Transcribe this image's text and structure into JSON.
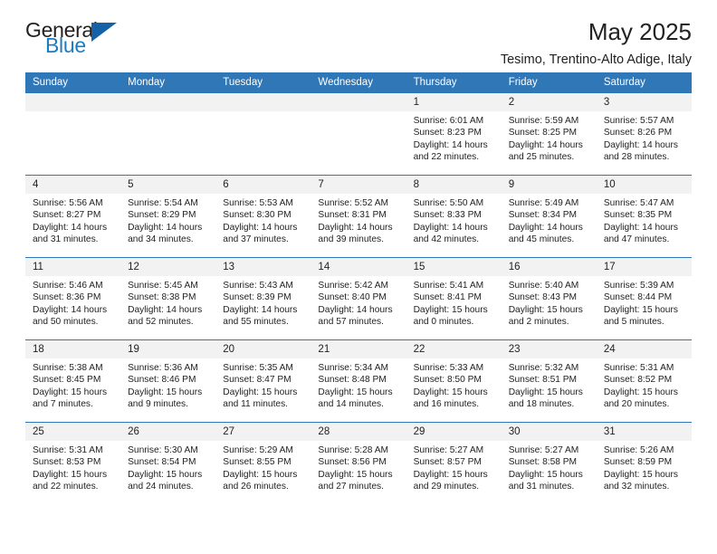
{
  "logo": {
    "word_top": "General",
    "word_bottom": "Blue",
    "triangle_color": "#1461a8",
    "blue_color": "#1c7cc0"
  },
  "header": {
    "title": "May 2025",
    "subtitle": "Tesimo, Trentino-Alto Adige, Italy"
  },
  "colors": {
    "header_row_bg": "#3077b8",
    "day_number_bg": "#f2f2f2",
    "text": "#222222"
  },
  "calendar": {
    "weekday_headers": [
      "Sunday",
      "Monday",
      "Tuesday",
      "Wednesday",
      "Thursday",
      "Friday",
      "Saturday"
    ],
    "labels": {
      "sunrise": "Sunrise:",
      "sunset": "Sunset:",
      "daylight": "Daylight:"
    },
    "weeks": [
      [
        {
          "day": "",
          "empty": true
        },
        {
          "day": "",
          "empty": true
        },
        {
          "day": "",
          "empty": true
        },
        {
          "day": "",
          "empty": true
        },
        {
          "day": "1",
          "sunrise": "Sunrise: 6:01 AM",
          "sunset": "Sunset: 8:23 PM",
          "daylight": "Daylight: 14 hours and 22 minutes."
        },
        {
          "day": "2",
          "sunrise": "Sunrise: 5:59 AM",
          "sunset": "Sunset: 8:25 PM",
          "daylight": "Daylight: 14 hours and 25 minutes."
        },
        {
          "day": "3",
          "sunrise": "Sunrise: 5:57 AM",
          "sunset": "Sunset: 8:26 PM",
          "daylight": "Daylight: 14 hours and 28 minutes."
        }
      ],
      [
        {
          "day": "4",
          "sunrise": "Sunrise: 5:56 AM",
          "sunset": "Sunset: 8:27 PM",
          "daylight": "Daylight: 14 hours and 31 minutes."
        },
        {
          "day": "5",
          "sunrise": "Sunrise: 5:54 AM",
          "sunset": "Sunset: 8:29 PM",
          "daylight": "Daylight: 14 hours and 34 minutes."
        },
        {
          "day": "6",
          "sunrise": "Sunrise: 5:53 AM",
          "sunset": "Sunset: 8:30 PM",
          "daylight": "Daylight: 14 hours and 37 minutes."
        },
        {
          "day": "7",
          "sunrise": "Sunrise: 5:52 AM",
          "sunset": "Sunset: 8:31 PM",
          "daylight": "Daylight: 14 hours and 39 minutes."
        },
        {
          "day": "8",
          "sunrise": "Sunrise: 5:50 AM",
          "sunset": "Sunset: 8:33 PM",
          "daylight": "Daylight: 14 hours and 42 minutes."
        },
        {
          "day": "9",
          "sunrise": "Sunrise: 5:49 AM",
          "sunset": "Sunset: 8:34 PM",
          "daylight": "Daylight: 14 hours and 45 minutes."
        },
        {
          "day": "10",
          "sunrise": "Sunrise: 5:47 AM",
          "sunset": "Sunset: 8:35 PM",
          "daylight": "Daylight: 14 hours and 47 minutes."
        }
      ],
      [
        {
          "day": "11",
          "sunrise": "Sunrise: 5:46 AM",
          "sunset": "Sunset: 8:36 PM",
          "daylight": "Daylight: 14 hours and 50 minutes."
        },
        {
          "day": "12",
          "sunrise": "Sunrise: 5:45 AM",
          "sunset": "Sunset: 8:38 PM",
          "daylight": "Daylight: 14 hours and 52 minutes."
        },
        {
          "day": "13",
          "sunrise": "Sunrise: 5:43 AM",
          "sunset": "Sunset: 8:39 PM",
          "daylight": "Daylight: 14 hours and 55 minutes."
        },
        {
          "day": "14",
          "sunrise": "Sunrise: 5:42 AM",
          "sunset": "Sunset: 8:40 PM",
          "daylight": "Daylight: 14 hours and 57 minutes."
        },
        {
          "day": "15",
          "sunrise": "Sunrise: 5:41 AM",
          "sunset": "Sunset: 8:41 PM",
          "daylight": "Daylight: 15 hours and 0 minutes."
        },
        {
          "day": "16",
          "sunrise": "Sunrise: 5:40 AM",
          "sunset": "Sunset: 8:43 PM",
          "daylight": "Daylight: 15 hours and 2 minutes."
        },
        {
          "day": "17",
          "sunrise": "Sunrise: 5:39 AM",
          "sunset": "Sunset: 8:44 PM",
          "daylight": "Daylight: 15 hours and 5 minutes."
        }
      ],
      [
        {
          "day": "18",
          "sunrise": "Sunrise: 5:38 AM",
          "sunset": "Sunset: 8:45 PM",
          "daylight": "Daylight: 15 hours and 7 minutes."
        },
        {
          "day": "19",
          "sunrise": "Sunrise: 5:36 AM",
          "sunset": "Sunset: 8:46 PM",
          "daylight": "Daylight: 15 hours and 9 minutes."
        },
        {
          "day": "20",
          "sunrise": "Sunrise: 5:35 AM",
          "sunset": "Sunset: 8:47 PM",
          "daylight": "Daylight: 15 hours and 11 minutes."
        },
        {
          "day": "21",
          "sunrise": "Sunrise: 5:34 AM",
          "sunset": "Sunset: 8:48 PM",
          "daylight": "Daylight: 15 hours and 14 minutes."
        },
        {
          "day": "22",
          "sunrise": "Sunrise: 5:33 AM",
          "sunset": "Sunset: 8:50 PM",
          "daylight": "Daylight: 15 hours and 16 minutes."
        },
        {
          "day": "23",
          "sunrise": "Sunrise: 5:32 AM",
          "sunset": "Sunset: 8:51 PM",
          "daylight": "Daylight: 15 hours and 18 minutes."
        },
        {
          "day": "24",
          "sunrise": "Sunrise: 5:31 AM",
          "sunset": "Sunset: 8:52 PM",
          "daylight": "Daylight: 15 hours and 20 minutes."
        }
      ],
      [
        {
          "day": "25",
          "sunrise": "Sunrise: 5:31 AM",
          "sunset": "Sunset: 8:53 PM",
          "daylight": "Daylight: 15 hours and 22 minutes."
        },
        {
          "day": "26",
          "sunrise": "Sunrise: 5:30 AM",
          "sunset": "Sunset: 8:54 PM",
          "daylight": "Daylight: 15 hours and 24 minutes."
        },
        {
          "day": "27",
          "sunrise": "Sunrise: 5:29 AM",
          "sunset": "Sunset: 8:55 PM",
          "daylight": "Daylight: 15 hours and 26 minutes."
        },
        {
          "day": "28",
          "sunrise": "Sunrise: 5:28 AM",
          "sunset": "Sunset: 8:56 PM",
          "daylight": "Daylight: 15 hours and 27 minutes."
        },
        {
          "day": "29",
          "sunrise": "Sunrise: 5:27 AM",
          "sunset": "Sunset: 8:57 PM",
          "daylight": "Daylight: 15 hours and 29 minutes."
        },
        {
          "day": "30",
          "sunrise": "Sunrise: 5:27 AM",
          "sunset": "Sunset: 8:58 PM",
          "daylight": "Daylight: 15 hours and 31 minutes."
        },
        {
          "day": "31",
          "sunrise": "Sunrise: 5:26 AM",
          "sunset": "Sunset: 8:59 PM",
          "daylight": "Daylight: 15 hours and 32 minutes."
        }
      ]
    ]
  }
}
